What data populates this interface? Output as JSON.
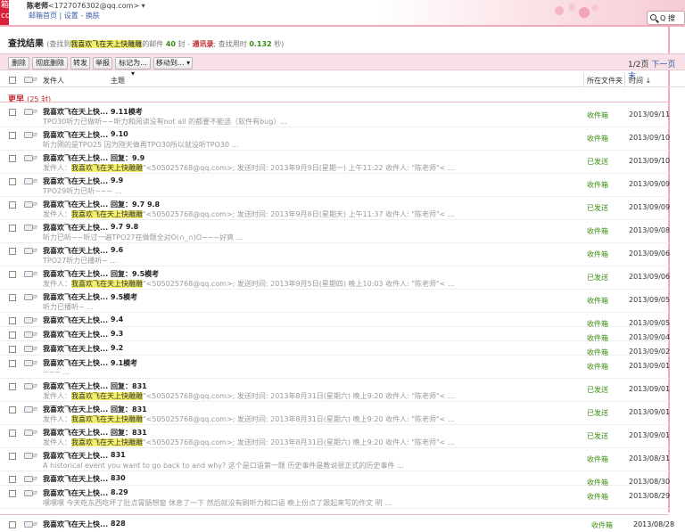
{
  "header": {
    "logo_text": "箱 com",
    "account_name": "陈老师",
    "account_email": "<1727076302@qq.com>",
    "links": [
      "邮箱首页",
      "设置",
      "换肤"
    ],
    "search_label": "Q 搜"
  },
  "results": {
    "title": "查找结果",
    "desc_prefix": "(查找到",
    "query": "我喜欢飞在天上快雕雕",
    "desc_mid": "的邮件",
    "count": "40",
    "desc_unit": "封",
    "contacts_label": "通讯录",
    "time_label": "; 查找用时",
    "time_value": "0.132",
    "time_unit": "秒)"
  },
  "toolbar": {
    "buttons": [
      "删除",
      "彻底删除",
      "转发",
      "举报",
      "标记为...",
      "移动到..."
    ],
    "pager": "1/2页",
    "next": "下一页",
    "last_page": "末"
  },
  "columns": {
    "from": "发件人",
    "subject": "主题",
    "folder": "所在文件夹",
    "time": "时间"
  },
  "group": {
    "label": "更早",
    "count": "(25 封)"
  },
  "rows": [
    {
      "from": "我喜欢飞在天上快...",
      "subject": "9.11模考",
      "preview": "TPO30听力已做听~~听力和阅读没有not all 的都要不能选（软件有bug）...",
      "hl": "",
      "folder": "收件箱",
      "date": "2013/09/11"
    },
    {
      "from": "我喜欢飞在天上快...",
      "subject": "9.10",
      "preview": "听力刚的是TPO25 因为刚天做再TPO30所以就没听TPO30 ...",
      "hl": "",
      "folder": "收件箱",
      "date": "2013/09/10"
    },
    {
      "from": "我喜欢飞在天上快...",
      "subject": "回复：9.9",
      "preview_a": "发件人：",
      "hl": "我喜欢飞在天上快雕雕",
      "preview_b": "\"<505025768@qq.com>; 发送时间: 2013年9月9日(星期一) 上午11:22 收件人: \"陈老师\"< ...",
      "folder": "已发送",
      "date": "2013/09/10"
    },
    {
      "from": "我喜欢飞在天上快...",
      "subject": "9.9",
      "preview": "TPO29听力已听~~~ ...",
      "hl": "",
      "folder": "收件箱",
      "date": "2013/09/09"
    },
    {
      "from": "我喜欢飞在天上快...",
      "subject": "回复：9.7 9.8",
      "preview_a": "发件人：",
      "hl": "我喜欢飞在天上快雕雕",
      "preview_b": "\"<505025768@qq.com>; 发送时间: 2013年9月8日(星期天) 上午11:37 收件人: \"陈老师\"< ...",
      "folder": "已发送",
      "date": "2013/09/09"
    },
    {
      "from": "我喜欢飞在天上快...",
      "subject": "9.7 9.8",
      "preview": "听力已听~~听过一遍TPO27在做题全对O(∩_∩)O~~~好爽 ...",
      "hl": "",
      "folder": "收件箱",
      "date": "2013/09/08"
    },
    {
      "from": "我喜欢飞在天上快...",
      "subject": "9.6",
      "preview": "TPO27听力已播听~ ...",
      "hl": "",
      "folder": "收件箱",
      "date": "2013/09/06"
    },
    {
      "from": "我喜欢飞在天上快...",
      "subject": "回复：9.5模考",
      "preview_a": "发件人：",
      "hl": "我喜欢飞在天上快雕雕",
      "preview_b": "\"<505025768@qq.com>; 发送时间: 2013年9月5日(星期四) 晚上10:03 收件人: \"陈老师\"< ...",
      "folder": "已发送",
      "date": "2013/09/06"
    },
    {
      "from": "我喜欢飞在天上快...",
      "subject": "9.5模考",
      "preview": "听力已播听~ ...",
      "hl": "",
      "folder": "收件箱",
      "date": "2013/09/05"
    },
    {
      "from": "我喜欢飞在天上快...",
      "subject": "9.4",
      "preview": "",
      "hl": "",
      "folder": "收件箱",
      "date": "2013/09/05"
    },
    {
      "from": "我喜欢飞在天上快...",
      "subject": "9.3",
      "preview": "",
      "hl": "",
      "folder": "收件箱",
      "date": "2013/09/04"
    },
    {
      "from": "我喜欢飞在天上快...",
      "subject": "9.2",
      "preview": "",
      "hl": "",
      "folder": "收件箱",
      "date": "2013/09/02"
    },
    {
      "from": "我喜欢飞在天上快...",
      "subject": "9.1模考",
      "preview": "~~~ ...",
      "hl": "",
      "folder": "收件箱",
      "date": "2013/09/01"
    },
    {
      "from": "我喜欢飞在天上快...",
      "subject": "回复：831",
      "preview_a": "发件人：",
      "hl": "我喜欢飞在天上快雕雕",
      "preview_b": "\"<505025768@qq.com>; 发送时间: 2013年8月31日(星期六) 晚上9:20 收件人: \"陈老师\"< ...",
      "folder": "已发送",
      "date": "2013/09/01"
    },
    {
      "from": "我喜欢飞在天上快...",
      "subject": "回复：831",
      "preview_a": "发件人：",
      "hl": "我喜欢飞在天上快雕雕",
      "preview_b": "\"<505025768@qq.com>; 发送时间: 2013年8月31日(星期六) 晚上9:20 收件人: \"陈老师\"< ...",
      "folder": "已发送",
      "date": "2013/09/01"
    },
    {
      "from": "我喜欢飞在天上快...",
      "subject": "回复：831",
      "preview_a": "发件人：",
      "hl": "我喜欢飞在天上快雕雕",
      "preview_b": "\"<505025768@qq.com>; 发送时间: 2013年8月31日(星期六) 晚上9:20 收件人: \"陈老师\"< ...",
      "folder": "已发送",
      "date": "2013/09/01"
    },
    {
      "from": "我喜欢飞在天上快...",
      "subject": "831",
      "preview": "A historical event you want to go back to and why? 这个是口语第一题 历史事件是教说很正式的历史事件 ...",
      "hl": "",
      "folder": "收件箱",
      "date": "2013/08/31"
    },
    {
      "from": "我喜欢飞在天上快...",
      "subject": "830",
      "preview": "",
      "hl": "",
      "folder": "收件箱",
      "date": "2013/08/30"
    },
    {
      "from": "我喜欢飞在天上快...",
      "subject": "8.29",
      "preview": "嘿嘿嘿 今天吃东西吃坏了肚点胃肠想窗 休息了一下 然后就没有刷听力和口语 晚上份点了跟起来写的作文 明 ...",
      "hl": "",
      "folder": "收件箱",
      "date": "2013/08/29"
    }
  ],
  "last_row": {
    "from": "我喜欢飞在天上快...",
    "subject": "828",
    "folder": "收件箱",
    "date": "2013/08/28"
  }
}
